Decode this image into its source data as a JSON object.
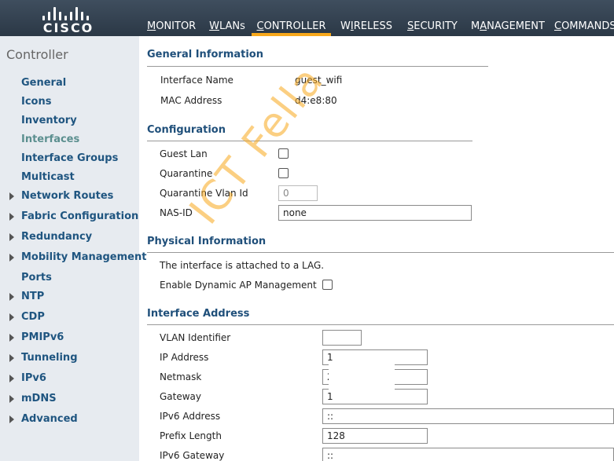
{
  "header": {
    "logo_text": "CISCO",
    "tabs": [
      {
        "label": "MONITOR",
        "accel": "M",
        "rest": "ONITOR"
      },
      {
        "label": "WLANs",
        "accel": "W",
        "rest": "LANs"
      },
      {
        "label": "CONTROLLER",
        "accel": "C",
        "rest": "ONTROLLER",
        "active": true
      },
      {
        "label": "WIRELESS",
        "accel": "W",
        "rest": "IRELESS",
        "accel_index": 1
      },
      {
        "label": "SECURITY",
        "accel": "S",
        "rest": "ECURITY"
      },
      {
        "label": "MANAGEMENT",
        "accel": "M",
        "rest": "ANAGEMENT",
        "accel_index": 1
      },
      {
        "label": "COMMANDS",
        "accel": "C",
        "rest": "OMMANDS"
      }
    ]
  },
  "sidebar": {
    "title": "Controller",
    "items": [
      {
        "label": "General",
        "expandable": false
      },
      {
        "label": "Icons",
        "expandable": false
      },
      {
        "label": "Inventory",
        "expandable": false
      },
      {
        "label": "Interfaces",
        "expandable": false,
        "active": true
      },
      {
        "label": "Interface Groups",
        "expandable": false
      },
      {
        "label": "Multicast",
        "expandable": false
      },
      {
        "label": "Network Routes",
        "expandable": true
      },
      {
        "label": "Fabric Configuration",
        "expandable": true
      },
      {
        "label": "Redundancy",
        "expandable": true
      },
      {
        "label": "Mobility Management",
        "expandable": true
      },
      {
        "label": "Ports",
        "expandable": false
      },
      {
        "label": "NTP",
        "expandable": true
      },
      {
        "label": "CDP",
        "expandable": true
      },
      {
        "label": "PMIPv6",
        "expandable": true
      },
      {
        "label": "Tunneling",
        "expandable": true
      },
      {
        "label": "IPv6",
        "expandable": true
      },
      {
        "label": "mDNS",
        "expandable": true
      },
      {
        "label": "Advanced",
        "expandable": true
      }
    ]
  },
  "general": {
    "title": "General Information",
    "interface_name_label": "Interface Name",
    "interface_name_value": "guest_wifi",
    "mac_label": "MAC Address",
    "mac_value": "d4:e8:80"
  },
  "configuration": {
    "title": "Configuration",
    "guest_lan_label": "Guest Lan",
    "guest_lan_checked": false,
    "quarantine_label": "Quarantine",
    "quarantine_checked": false,
    "quarantine_vlan_label": "Quarantine Vlan Id",
    "quarantine_vlan_value": "0",
    "nas_id_label": "NAS-ID",
    "nas_id_value": "none"
  },
  "physical": {
    "title": "Physical Information",
    "lag_text": "The interface is attached to a LAG.",
    "dynamic_ap_label": "Enable Dynamic AP Management",
    "dynamic_ap_checked": false
  },
  "address": {
    "title": "Interface Address",
    "vlan_label": "VLAN Identifier",
    "vlan_value": "",
    "ip_label": "IP Address",
    "ip_value": "1",
    "netmask_label": "Netmask",
    "netmask_value": "2",
    "gateway_label": "Gateway",
    "gateway_value": "1",
    "ipv6_label": "IPv6 Address",
    "ipv6_value": "::",
    "prefix_label": "Prefix Length",
    "prefix_value": "128",
    "ipv6_gw_label": "IPv6 Gateway",
    "ipv6_gw_value": "::"
  },
  "watermark": "ICT Fella",
  "colors": {
    "header_bg": "#34414f",
    "active_tab_underline": "#f7a81b",
    "sidebar_bg": "#e7ebf0",
    "nav_link": "#1f5580",
    "nav_active": "#5b8f8f",
    "section_title": "#1f4f7a",
    "watermark": "#f7a81b"
  }
}
